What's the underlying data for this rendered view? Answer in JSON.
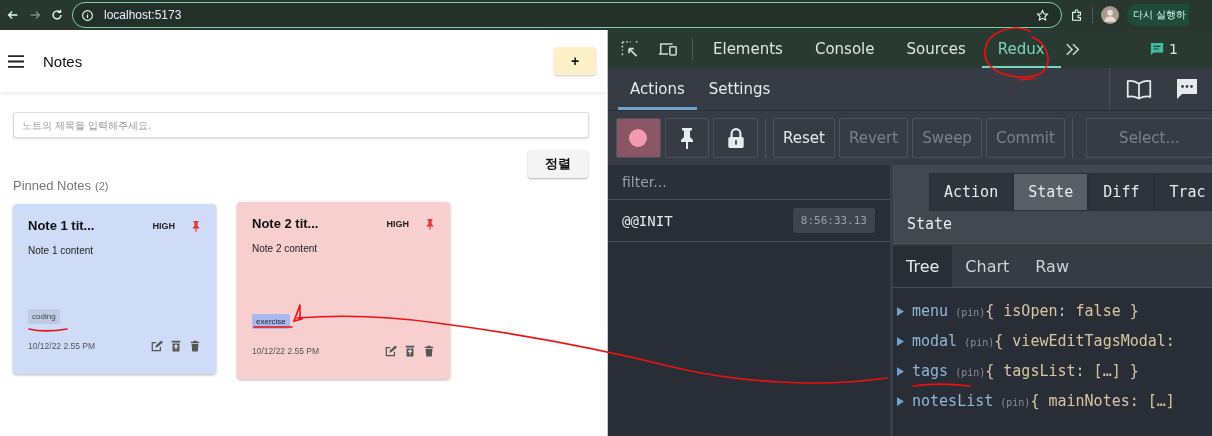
{
  "browser": {
    "url": "localhost:5173",
    "relaunch_button": "다시 실행하"
  },
  "app": {
    "title": "Notes",
    "add_button": "+",
    "search": {
      "placeholder": "노트의 제목을 입력해주세요."
    },
    "sort_button": "정렬",
    "section": {
      "title": "Pinned Notes",
      "count": "(2)"
    },
    "notes": [
      {
        "title": "Note 1 tit...",
        "priority": "HIGH",
        "pinned": true,
        "content": "Note 1 content",
        "tags": [
          {
            "label": "coding",
            "selected": false
          }
        ],
        "date": "10/12/22 2.55 PM",
        "color": "#cfdcf8"
      },
      {
        "title": "Note 2 tit...",
        "priority": "HIGH",
        "pinned": true,
        "content": "Note 2 content",
        "tags": [
          {
            "label": "exercise",
            "selected": true
          }
        ],
        "date": "10/12/22 2.55 PM",
        "color": "#f7cfcf"
      }
    ]
  },
  "devtools": {
    "tabs": [
      {
        "label": "Elements",
        "selected": false
      },
      {
        "label": "Console",
        "selected": false
      },
      {
        "label": "Sources",
        "selected": false
      },
      {
        "label": "Redux",
        "selected": true
      }
    ],
    "issues_count": "1",
    "redux": {
      "tabs": [
        {
          "label": "Actions",
          "selected": true
        },
        {
          "label": "Settings",
          "selected": false
        }
      ],
      "recording": true,
      "buttons": [
        {
          "label": "Reset",
          "disabled": false
        },
        {
          "label": "Revert",
          "disabled": true
        },
        {
          "label": "Sweep",
          "disabled": true
        },
        {
          "label": "Commit",
          "disabled": true
        }
      ],
      "select_placeholder": "Select...",
      "filter_placeholder": "filter...",
      "actions": [
        {
          "name": "@@INIT",
          "time": "8:56:33.13"
        }
      ],
      "monitor_tabs": [
        {
          "label": "Action",
          "selected": false
        },
        {
          "label": "State",
          "selected": true
        },
        {
          "label": "Diff",
          "selected": false
        },
        {
          "label": "Trac",
          "selected": false
        }
      ],
      "state_title": "State",
      "view_tabs": [
        {
          "label": "Tree",
          "selected": true
        },
        {
          "label": "Chart",
          "selected": false
        },
        {
          "label": "Raw",
          "selected": false
        }
      ],
      "tree": [
        {
          "key": "menu",
          "pin": "(pin)",
          "value": "{ isOpen: false }"
        },
        {
          "key": "modal",
          "pin": "(pin)",
          "value": "{ viewEditTagsModal:"
        },
        {
          "key": "tags",
          "pin": "(pin)",
          "value": "{ tagsList: […] }"
        },
        {
          "key": "notesList",
          "pin": "(pin)",
          "value": "{ mainNotes: […]"
        }
      ]
    }
  }
}
